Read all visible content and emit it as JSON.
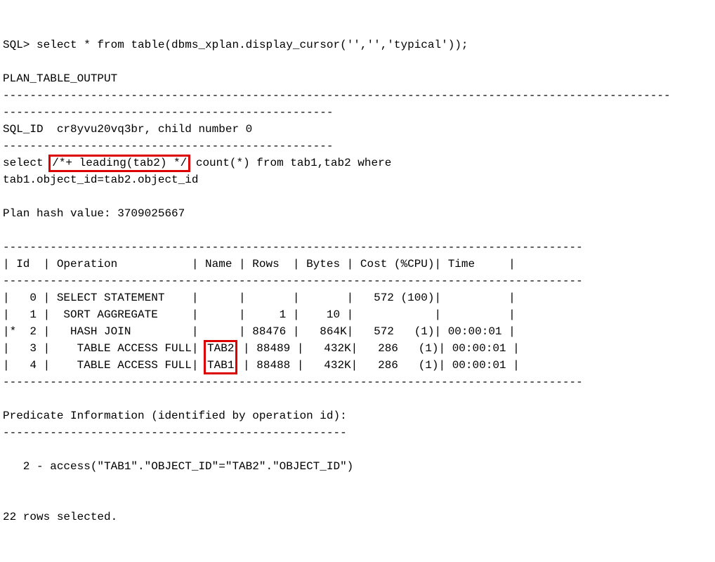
{
  "prompt": "SQL> ",
  "command": "select * from table(dbms_xplan.display_cursor('','','typical'));",
  "heading": "PLAN_TABLE_OUTPUT",
  "rule_long": "---------------------------------------------------------------------------------------------------",
  "rule_half": "-------------------------------------------------",
  "sql_id_line": "SQL_ID  cr8yvu20vq3br, child number 0",
  "sql_text_l1_pre": "select ",
  "sql_text_l1_hint": "/*+ leading(tab2) */",
  "sql_text_l1_post": " count(*) from tab1,tab2 where",
  "sql_text_l2": "tab1.object_id=tab2.object_id",
  "plan_hash_line": "Plan hash value: 3709025667",
  "plan_rule": "--------------------------------------------------------------------------------------",
  "plan_header": "| Id  | Operation           | Name | Rows  | Bytes | Cost (%CPU)| Time     |",
  "plan_rows": {
    "r0": "|   0 | SELECT STATEMENT    |      |       |       |   572 (100)|          |",
    "r1": "|   1 |  SORT AGGREGATE     |      |     1 |    10 |            |          |",
    "r2": "|*  2 |   HASH JOIN         |      | 88476 |   864K|   572   (1)| 00:00:01 |",
    "r3_pre": "|   3 |    TABLE ACCESS FULL| ",
    "r3_name": "TAB2",
    "r3_post": " | 88489 |   432K|   286   (1)| 00:00:01 |",
    "r4_pre": "|   4 |    TABLE ACCESS FULL| ",
    "r4_name": "TAB1",
    "r4_post": " | 88488 |   432K|   286   (1)| 00:00:01 |"
  },
  "pred_heading": "Predicate Information (identified by operation id):",
  "pred_rule": "---------------------------------------------------",
  "pred_line": "   2 - access(\"TAB1\".\"OBJECT_ID\"=\"TAB2\".\"OBJECT_ID\")",
  "rows_selected": "22 rows selected.",
  "chart_data": {
    "type": "table",
    "title": "Execution Plan",
    "columns": [
      "Id",
      "Operation",
      "Name",
      "Rows",
      "Bytes",
      "Cost (%CPU)",
      "Time"
    ],
    "rows": [
      {
        "Id": 0,
        "Operation": "SELECT STATEMENT",
        "Name": "",
        "Rows": null,
        "Bytes": null,
        "Cost": "572 (100)",
        "Time": ""
      },
      {
        "Id": 1,
        "Operation": "SORT AGGREGATE",
        "Name": "",
        "Rows": 1,
        "Bytes": 10,
        "Cost": "",
        "Time": ""
      },
      {
        "Id": 2,
        "Operation": "HASH JOIN",
        "Name": "",
        "Rows": 88476,
        "Bytes": "864K",
        "Cost": "572 (1)",
        "Time": "00:00:01"
      },
      {
        "Id": 3,
        "Operation": "TABLE ACCESS FULL",
        "Name": "TAB2",
        "Rows": 88489,
        "Bytes": "432K",
        "Cost": "286 (1)",
        "Time": "00:00:01"
      },
      {
        "Id": 4,
        "Operation": "TABLE ACCESS FULL",
        "Name": "TAB1",
        "Rows": 88488,
        "Bytes": "432K",
        "Cost": "286 (1)",
        "Time": "00:00:01"
      }
    ],
    "sql_id": "cr8yvu20vq3br",
    "child_number": 0,
    "plan_hash_value": 3709025667,
    "hint": "leading(tab2)",
    "predicate": "access(\"TAB1\".\"OBJECT_ID\"=\"TAB2\".\"OBJECT_ID\")"
  }
}
